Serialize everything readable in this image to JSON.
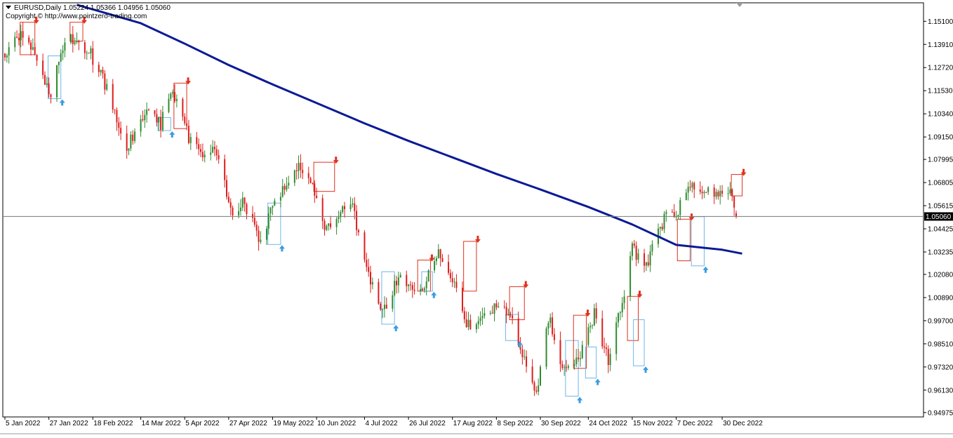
{
  "header": {
    "symbol_line": "EURUSD,Daily  1.05224 1.05366 1.04956 1.05060",
    "copyright": "Copyright © http://www.pointzero-trading.com"
  },
  "colors": {
    "bull": "#2e8b2e",
    "bear": "#e01b1b",
    "ma": "#0a1a96",
    "sell_box": "#e0301e",
    "buy_box": "#6fb6e8",
    "sell_arrow": "#e0301e",
    "buy_arrow": "#3a9be0",
    "price_line": "#7a7a7a",
    "price_tag_bg": "#000000",
    "price_tag_text": "#ffffff",
    "axis": "#000000"
  },
  "chart_data": {
    "type": "candlestick",
    "symbol": "EURUSD",
    "timeframe": "Daily",
    "ohlc_last": {
      "open": 1.05224,
      "high": 1.05366,
      "low": 1.04956,
      "close": 1.0506
    },
    "current_price_label": "1.05060",
    "current_price": 1.0506,
    "y_range": [
      0.9475,
      1.1605
    ],
    "x_range": [
      "2022-01-05",
      "2023-01-13"
    ],
    "y_ticks": [
      "1.15100",
      "1.13910",
      "1.12720",
      "1.11530",
      "1.10340",
      "1.09150",
      "1.07995",
      "1.06805",
      "1.05615",
      "1.04425",
      "1.03235",
      "1.02080",
      "1.00890",
      "0.99700",
      "0.98510",
      "0.97320",
      "0.96130",
      "0.94975"
    ],
    "x_ticks": [
      {
        "label": "5 Jan 2022",
        "date": "2022-01-05"
      },
      {
        "label": "27 Jan 2022",
        "date": "2022-01-27"
      },
      {
        "label": "18 Feb 2022",
        "date": "2022-02-18"
      },
      {
        "label": "14 Mar 2022",
        "date": "2022-03-14"
      },
      {
        "label": "5 Apr 2022",
        "date": "2022-04-05"
      },
      {
        "label": "27 Apr 2022",
        "date": "2022-04-27"
      },
      {
        "label": "19 May 2022",
        "date": "2022-05-19"
      },
      {
        "label": "10 Jun 2022",
        "date": "2022-06-10"
      },
      {
        "label": "4 Jul 2022",
        "date": "2022-07-04"
      },
      {
        "label": "26 Jul 2022",
        "date": "2022-07-26"
      },
      {
        "label": "17 Aug 2022",
        "date": "2022-08-17"
      },
      {
        "label": "8 Sep 2022",
        "date": "2022-09-08"
      },
      {
        "label": "30 Sep 2022",
        "date": "2022-09-30"
      },
      {
        "label": "24 Oct 2022",
        "date": "2022-10-24"
      },
      {
        "label": "15 Nov 2022",
        "date": "2022-11-15"
      },
      {
        "label": "7 Dec 2022",
        "date": "2022-12-07"
      },
      {
        "label": "30 Dec 2022",
        "date": "2022-12-30"
      }
    ],
    "price_path": [
      {
        "date": "2022-01-05",
        "price": 1.131
      },
      {
        "date": "2022-01-13",
        "price": 1.146
      },
      {
        "date": "2022-01-20",
        "price": 1.134
      },
      {
        "date": "2022-01-28",
        "price": 1.114
      },
      {
        "date": "2022-02-04",
        "price": 1.143
      },
      {
        "date": "2022-02-10",
        "price": 1.142
      },
      {
        "date": "2022-02-17",
        "price": 1.134
      },
      {
        "date": "2022-02-24",
        "price": 1.119
      },
      {
        "date": "2022-03-07",
        "price": 1.087
      },
      {
        "date": "2022-03-16",
        "price": 1.103
      },
      {
        "date": "2022-03-24",
        "price": 1.098
      },
      {
        "date": "2022-03-30",
        "price": 1.116
      },
      {
        "date": "2022-04-07",
        "price": 1.091
      },
      {
        "date": "2022-04-14",
        "price": 1.083
      },
      {
        "date": "2022-04-21",
        "price": 1.085
      },
      {
        "date": "2022-04-28",
        "price": 1.052
      },
      {
        "date": "2022-05-05",
        "price": 1.058
      },
      {
        "date": "2022-05-12",
        "price": 1.038
      },
      {
        "date": "2022-05-20",
        "price": 1.057
      },
      {
        "date": "2022-05-30",
        "price": 1.076
      },
      {
        "date": "2022-06-06",
        "price": 1.072
      },
      {
        "date": "2022-06-14",
        "price": 1.042
      },
      {
        "date": "2022-06-20",
        "price": 1.052
      },
      {
        "date": "2022-06-27",
        "price": 1.058
      },
      {
        "date": "2022-07-01",
        "price": 1.043
      },
      {
        "date": "2022-07-07",
        "price": 1.017
      },
      {
        "date": "2022-07-14",
        "price": 1.002
      },
      {
        "date": "2022-07-21",
        "price": 1.019
      },
      {
        "date": "2022-07-27",
        "price": 1.014
      },
      {
        "date": "2022-08-03",
        "price": 1.016
      },
      {
        "date": "2022-08-10",
        "price": 1.031
      },
      {
        "date": "2022-08-17",
        "price": 1.017
      },
      {
        "date": "2022-08-24",
        "price": 0.995
      },
      {
        "date": "2022-09-01",
        "price": 0.998
      },
      {
        "date": "2022-09-09",
        "price": 1.004
      },
      {
        "date": "2022-09-15",
        "price": 0.999
      },
      {
        "date": "2022-09-23",
        "price": 0.972
      },
      {
        "date": "2022-09-28",
        "price": 0.959
      },
      {
        "date": "2022-10-04",
        "price": 0.999
      },
      {
        "date": "2022-10-12",
        "price": 0.971
      },
      {
        "date": "2022-10-19",
        "price": 0.978
      },
      {
        "date": "2022-10-27",
        "price": 1.001
      },
      {
        "date": "2022-11-03",
        "price": 0.976
      },
      {
        "date": "2022-11-10",
        "price": 1.006
      },
      {
        "date": "2022-11-15",
        "price": 1.034
      },
      {
        "date": "2022-11-22",
        "price": 1.026
      },
      {
        "date": "2022-11-28",
        "price": 1.042
      },
      {
        "date": "2022-12-02",
        "price": 1.051
      },
      {
        "date": "2022-12-07",
        "price": 1.052
      },
      {
        "date": "2022-12-14",
        "price": 1.066
      },
      {
        "date": "2022-12-22",
        "price": 1.062
      },
      {
        "date": "2022-12-28",
        "price": 1.064
      },
      {
        "date": "2023-01-04",
        "price": 1.061
      },
      {
        "date": "2023-01-06",
        "price": 1.0506
      }
    ],
    "moving_average": [
      {
        "date": "2022-02-10",
        "price": 1.1595
      },
      {
        "date": "2022-03-14",
        "price": 1.15
      },
      {
        "date": "2022-04-05",
        "price": 1.1395
      },
      {
        "date": "2022-04-27",
        "price": 1.1285
      },
      {
        "date": "2022-05-19",
        "price": 1.1185
      },
      {
        "date": "2022-06-10",
        "price": 1.109
      },
      {
        "date": "2022-07-04",
        "price": 1.0985
      },
      {
        "date": "2022-07-26",
        "price": 1.0895
      },
      {
        "date": "2022-08-17",
        "price": 1.081
      },
      {
        "date": "2022-09-08",
        "price": 1.0725
      },
      {
        "date": "2022-09-30",
        "price": 1.0645
      },
      {
        "date": "2022-10-24",
        "price": 1.0555
      },
      {
        "date": "2022-11-15",
        "price": 1.0465
      },
      {
        "date": "2022-12-07",
        "price": 1.036
      },
      {
        "date": "2022-12-30",
        "price": 1.0335
      },
      {
        "date": "2023-01-09",
        "price": 1.0315
      }
    ],
    "signals": [
      {
        "type": "sell",
        "date": "2022-01-14",
        "top": 1.1505,
        "bottom": 1.1338,
        "days": 6
      },
      {
        "type": "buy",
        "date": "2022-01-28",
        "top": 1.1332,
        "bottom": 1.1112,
        "days": 5
      },
      {
        "type": "sell",
        "date": "2022-02-08",
        "top": 1.1505,
        "bottom": 1.1408,
        "days": 5
      },
      {
        "type": "buy",
        "date": "2022-03-24",
        "top": 1.1015,
        "bottom": 1.0948,
        "days": 5
      },
      {
        "type": "sell",
        "date": "2022-04-01",
        "top": 1.1192,
        "bottom": 1.0958,
        "days": 5
      },
      {
        "type": "buy",
        "date": "2022-05-18",
        "top": 1.0575,
        "bottom": 1.0362,
        "days": 5
      },
      {
        "type": "sell",
        "date": "2022-06-10",
        "top": 1.0785,
        "bottom": 1.0635,
        "days": 9
      },
      {
        "type": "buy",
        "date": "2022-07-14",
        "top": 1.0222,
        "bottom": 0.9952,
        "days": 5
      },
      {
        "type": "sell",
        "date": "2022-08-01",
        "top": 1.0282,
        "bottom": 1.0122,
        "days": 5
      },
      {
        "type": "buy",
        "date": "2022-08-03",
        "top": 1.0222,
        "bottom": 1.0122,
        "days": 4
      },
      {
        "type": "sell",
        "date": "2022-08-24",
        "top": 1.0378,
        "bottom": 1.0122,
        "days": 5
      },
      {
        "type": "buy",
        "date": "2022-09-14",
        "top": 1.0002,
        "bottom": 0.9868,
        "days": 5
      },
      {
        "type": "sell",
        "date": "2022-09-16",
        "top": 1.0145,
        "bottom": 0.9975,
        "days": 6
      },
      {
        "type": "buy",
        "date": "2022-10-14",
        "top": 0.9868,
        "bottom": 0.9582,
        "days": 5
      },
      {
        "type": "sell",
        "date": "2022-10-18",
        "top": 0.9998,
        "bottom": 0.9725,
        "days": 5
      },
      {
        "type": "buy",
        "date": "2022-10-24",
        "top": 0.9835,
        "bottom": 0.9675,
        "days": 4
      },
      {
        "type": "sell",
        "date": "2022-11-14",
        "top": 1.0095,
        "bottom": 0.9868,
        "days": 4
      },
      {
        "type": "buy",
        "date": "2022-11-17",
        "top": 0.9975,
        "bottom": 0.9738,
        "days": 4
      },
      {
        "type": "sell",
        "date": "2022-12-09",
        "top": 1.0492,
        "bottom": 1.0278,
        "days": 5
      },
      {
        "type": "buy",
        "date": "2022-12-16",
        "top": 1.0505,
        "bottom": 1.0252,
        "days": 5
      },
      {
        "type": "sell",
        "date": "2023-01-05",
        "top": 1.0722,
        "bottom": 1.0612,
        "days": 4
      }
    ]
  }
}
